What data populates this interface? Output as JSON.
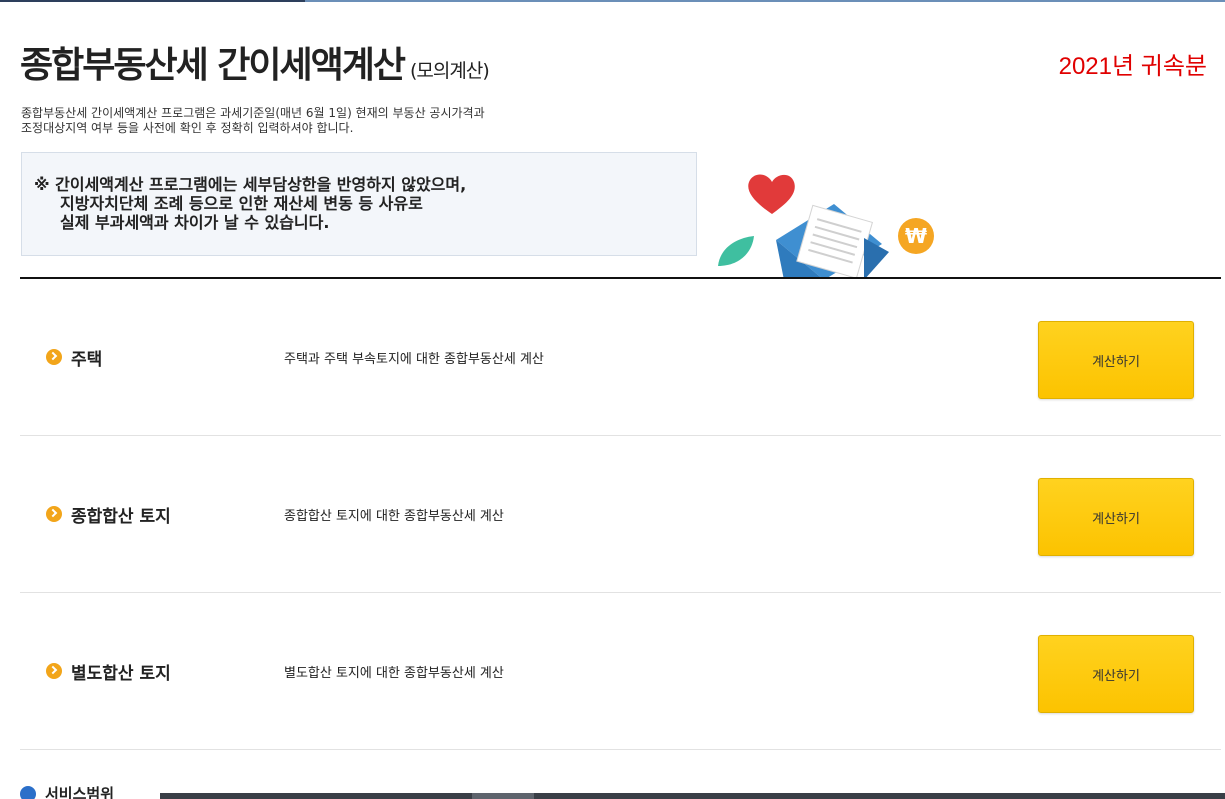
{
  "header": {
    "title": "종합부동산세 간이세액계산",
    "title_sub": "(모의계산)",
    "year": "2021년 귀속분"
  },
  "intro": {
    "line1": "종합부동산세 간이세액계산 프로그램은 과세기준일(매년 6월 1일) 현재의 부동산 공시가격과",
    "line2": "조정대상지역 여부 등을 사전에 확인 후 정확히 입력하셔야 합니다."
  },
  "notice": {
    "line1": "※ 간이세액계산 프로그램에는 세부담상한을 반영하지 않았으며,",
    "line2": "지방자치단체 조례 등으로 인한 재산세 변동 등 사유로",
    "line3": "실제 부과세액과 차이가 날 수 있습니다."
  },
  "illustration": {
    "icons": [
      "heart-icon",
      "leaf-icon",
      "envelope-icon",
      "won-coin-icon"
    ],
    "coin_symbol": "₩"
  },
  "rows": [
    {
      "label": "주택",
      "description": "주택과 주택 부속토지에 대한 종합부동산세 계산",
      "button": "계산하기"
    },
    {
      "label": "종합합산 토지",
      "description": "종합합산 토지에 대한 종합부동산세 계산",
      "button": "계산하기"
    },
    {
      "label": "별도합산 토지",
      "description": "별도합산 토지에 대한 종합부동산세 계산",
      "button": "계산하기"
    }
  ],
  "footer": {
    "scope_label": "서비스범위"
  },
  "colors": {
    "year": "#e00000",
    "button": "#fcc300",
    "bullet": "#f2a51a",
    "notice_bg": "#f3f6fa"
  }
}
